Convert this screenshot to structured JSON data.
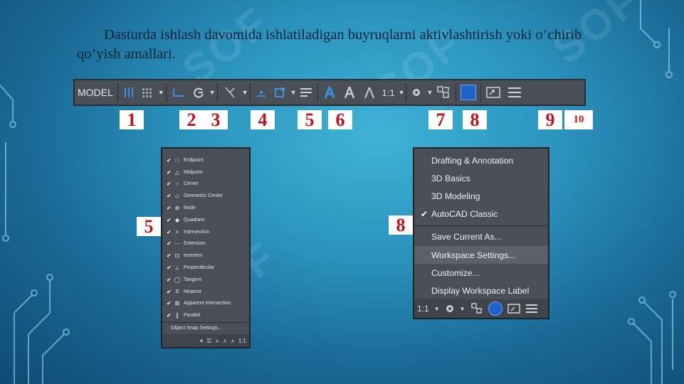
{
  "slide": {
    "title": "Dasturda ishlash davomida ishlatiladigan buyruqlarni aktivlashtirish yoki o’chirib qo’yish amallari.",
    "accent_red": "#c1121b"
  },
  "statusbar": {
    "model_label": "MODEL",
    "scale_label": "1:1"
  },
  "callouts": [
    "1",
    "2",
    "3",
    "4",
    "5",
    "6",
    "7",
    "8",
    "9",
    "10"
  ],
  "panel_callouts": {
    "osnap": "5",
    "workspace": "8"
  },
  "osnap_menu": {
    "items": [
      {
        "label": "Endpoint",
        "icon": "endpoint-icon",
        "checked": true
      },
      {
        "label": "Midpoint",
        "icon": "midpoint-icon",
        "checked": true
      },
      {
        "label": "Center",
        "icon": "center-icon",
        "checked": true
      },
      {
        "label": "Geometric Center",
        "icon": "geometric-center-icon",
        "checked": true
      },
      {
        "label": "Node",
        "icon": "node-icon",
        "checked": true
      },
      {
        "label": "Quadrant",
        "icon": "quadrant-icon",
        "checked": true
      },
      {
        "label": "Intersection",
        "icon": "intersection-icon",
        "checked": true
      },
      {
        "label": "Extension",
        "icon": "extension-icon",
        "checked": true
      },
      {
        "label": "Insertion",
        "icon": "insertion-icon",
        "checked": true
      },
      {
        "label": "Perpendicular",
        "icon": "perpendicular-icon",
        "checked": true
      },
      {
        "label": "Tangent",
        "icon": "tangent-icon",
        "checked": true
      },
      {
        "label": "Nearest",
        "icon": "nearest-icon",
        "checked": true
      },
      {
        "label": "Apparent Intersection",
        "icon": "apparent-intersection-icon",
        "checked": true
      },
      {
        "label": "Parallel",
        "icon": "parallel-icon",
        "checked": true
      }
    ],
    "settings_label": "Object Snap Settings...",
    "bar_scale": "1:1"
  },
  "workspace_menu": {
    "items": [
      "Drafting & Annotation",
      "3D Basics",
      "3D Modeling",
      "AutoCAD Classic"
    ],
    "checked_item": "AutoCAD Classic",
    "actions": [
      "Save Current As...",
      "Workspace Settings...",
      "Customize...",
      "Display Workspace Label"
    ],
    "highlighted_action": "Workspace Settings...",
    "bar_scale": "1:1"
  }
}
